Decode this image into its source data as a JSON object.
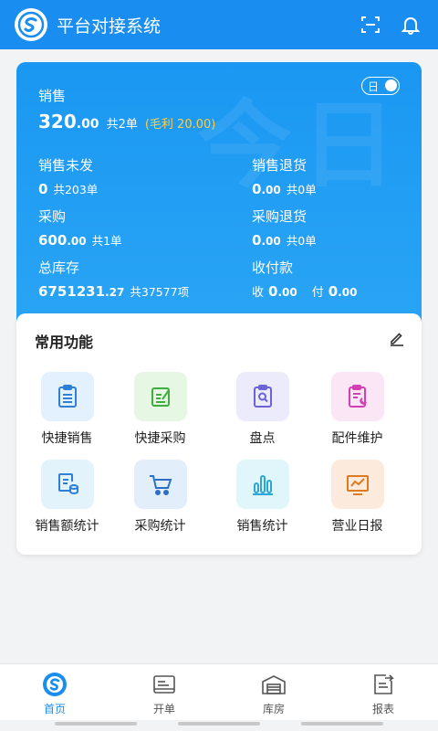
{
  "header": {
    "title": "平台对接系统",
    "logo_icon": "brand-s-icon"
  },
  "stats": {
    "toggle_label": "日",
    "watermark": "今日",
    "sales": {
      "label": "销售",
      "int": "320",
      "dec": ".00",
      "count": "共2单",
      "profit": "(毛利 20.00)"
    },
    "unshipped": {
      "label": "销售未发",
      "int": "0",
      "dec": "",
      "count": "共203单"
    },
    "sales_return": {
      "label": "销售退货",
      "int": "0",
      "dec": ".00",
      "count": "共0单"
    },
    "purchase": {
      "label": "采购",
      "int": "600",
      "dec": ".00",
      "count": "共1单"
    },
    "purchase_return": {
      "label": "采购退货",
      "int": "0",
      "dec": ".00",
      "count": "共0单"
    },
    "inventory": {
      "label": "总库存",
      "int": "6751231",
      "dec": ".27",
      "count": "共37577项"
    },
    "payments": {
      "label": "收付款",
      "receive_word": "收",
      "receive_int": "0",
      "receive_dec": ".00",
      "pay_word": "付",
      "pay_int": "0",
      "pay_dec": ".00"
    }
  },
  "functions": {
    "title": "常用功能",
    "items": [
      {
        "label": "快捷销售",
        "icon": "clipboard-list-icon",
        "color": "#2e7fd6",
        "bg": "#e3f0fd"
      },
      {
        "label": "快捷采购",
        "icon": "note-edit-icon",
        "color": "#3fae3f",
        "bg": "#e6f7e4"
      },
      {
        "label": "盘点",
        "icon": "clipboard-search-icon",
        "color": "#6b63d6",
        "bg": "#ecebfb"
      },
      {
        "label": "配件维护",
        "icon": "clipboard-wrench-icon",
        "color": "#d63fb4",
        "bg": "#fbe6f6"
      },
      {
        "label": "销售额统计",
        "icon": "doc-coins-icon",
        "color": "#2e7fd6",
        "bg": "#e3f3fb"
      },
      {
        "label": "采购统计",
        "icon": "cart-icon",
        "color": "#2e6fc6",
        "bg": "#e3eefb"
      },
      {
        "label": "销售统计",
        "icon": "bar-chart-icon",
        "color": "#2aa7d6",
        "bg": "#e1f6fb"
      },
      {
        "label": "营业日报",
        "icon": "trend-board-icon",
        "color": "#e07a1e",
        "bg": "#fcebdc"
      }
    ]
  },
  "tabs": [
    {
      "label": "首页",
      "icon": "home-s-icon",
      "active": true
    },
    {
      "label": "开单",
      "icon": "order-card-icon",
      "active": false
    },
    {
      "label": "库房",
      "icon": "warehouse-icon",
      "active": false
    },
    {
      "label": "报表",
      "icon": "report-icon",
      "active": false
    }
  ],
  "colors": {
    "primary": "#1a8ef0",
    "profit": "#ffcf40"
  }
}
